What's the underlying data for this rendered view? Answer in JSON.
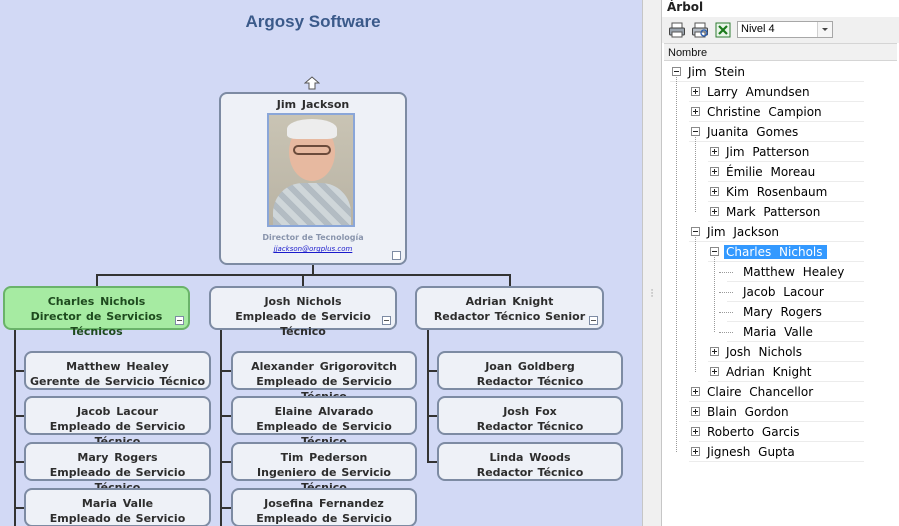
{
  "canvas": {
    "title": "Argosy Software",
    "root": {
      "name": "Jim  Jackson",
      "title": "Director de Tecnología",
      "email": "jjackson@orgplus.com"
    },
    "managers": [
      {
        "name": "Charles  Nichols",
        "title": "Director de Servicios Técnicos",
        "selected": true
      },
      {
        "name": "Josh  Nichols",
        "title": "Empleado de Servicio Técnico"
      },
      {
        "name": "Adrian  Knight",
        "title": "Redactor Técnico Senior"
      }
    ],
    "reports_col1": [
      {
        "name": "Matthew  Healey",
        "title": "Gerente de Servicio Técnico"
      },
      {
        "name": "Jacob  Lacour",
        "title": "Empleado de Servicio Técnico"
      },
      {
        "name": "Mary  Rogers",
        "title": "Empleado de Servicio Técnico"
      },
      {
        "name": "Maria  Valle",
        "title": "Empleado de Servicio Técnico"
      }
    ],
    "reports_col2": [
      {
        "name": "Alexander  Grigorovitch",
        "title": "Empleado de Servicio Técnico"
      },
      {
        "name": "Elaine  Alvarado",
        "title": "Empleado de Servicio Técnico"
      },
      {
        "name": "Tim  Pederson",
        "title": "Ingeniero de Servicio Técnico"
      },
      {
        "name": "Josefina  Fernandez",
        "title": "Empleado de Servicio Técnico"
      }
    ],
    "reports_col3": [
      {
        "name": "Joan  Goldberg",
        "title": "Redactor Técnico"
      },
      {
        "name": "Josh  Fox",
        "title": "Redactor Técnico"
      },
      {
        "name": "Linda  Woods",
        "title": "Redactor Técnico"
      }
    ]
  },
  "panel": {
    "title": "Árbol",
    "toolbar": {
      "print_icon": "printer-icon",
      "print_preview_icon": "print-preview-icon",
      "excel_icon": "excel-export-icon",
      "level_selected": "Nivel 4"
    },
    "column_header": "Nombre",
    "tree": [
      {
        "label": "Jim  Stein",
        "depth": 0,
        "state": "minus"
      },
      {
        "label": "Larry  Amundsen",
        "depth": 1,
        "state": "plus"
      },
      {
        "label": "Christine  Campion",
        "depth": 1,
        "state": "plus"
      },
      {
        "label": "Juanita  Gomes",
        "depth": 1,
        "state": "minus"
      },
      {
        "label": "Jim  Patterson",
        "depth": 2,
        "state": "plus"
      },
      {
        "label": "Émilie  Moreau",
        "depth": 2,
        "state": "plus"
      },
      {
        "label": "Kim  Rosenbaum",
        "depth": 2,
        "state": "plus"
      },
      {
        "label": "Mark  Patterson",
        "depth": 2,
        "state": "plus"
      },
      {
        "label": "Jim  Jackson",
        "depth": 1,
        "state": "minus"
      },
      {
        "label": "Charles  Nichols",
        "depth": 2,
        "state": "minus",
        "selected": true
      },
      {
        "label": "Matthew  Healey",
        "depth": 3,
        "state": "none"
      },
      {
        "label": "Jacob  Lacour",
        "depth": 3,
        "state": "none"
      },
      {
        "label": "Mary  Rogers",
        "depth": 3,
        "state": "none"
      },
      {
        "label": "Maria  Valle",
        "depth": 3,
        "state": "none"
      },
      {
        "label": "Josh  Nichols",
        "depth": 2,
        "state": "plus"
      },
      {
        "label": "Adrian  Knight",
        "depth": 2,
        "state": "plus"
      },
      {
        "label": "Claire  Chancellor",
        "depth": 1,
        "state": "plus"
      },
      {
        "label": "Blain Gordon",
        "depth": 1,
        "state": "plus"
      },
      {
        "label": "Roberto  Garcis",
        "depth": 1,
        "state": "plus"
      },
      {
        "label": "Jignesh  Gupta",
        "depth": 1,
        "state": "plus"
      }
    ]
  }
}
